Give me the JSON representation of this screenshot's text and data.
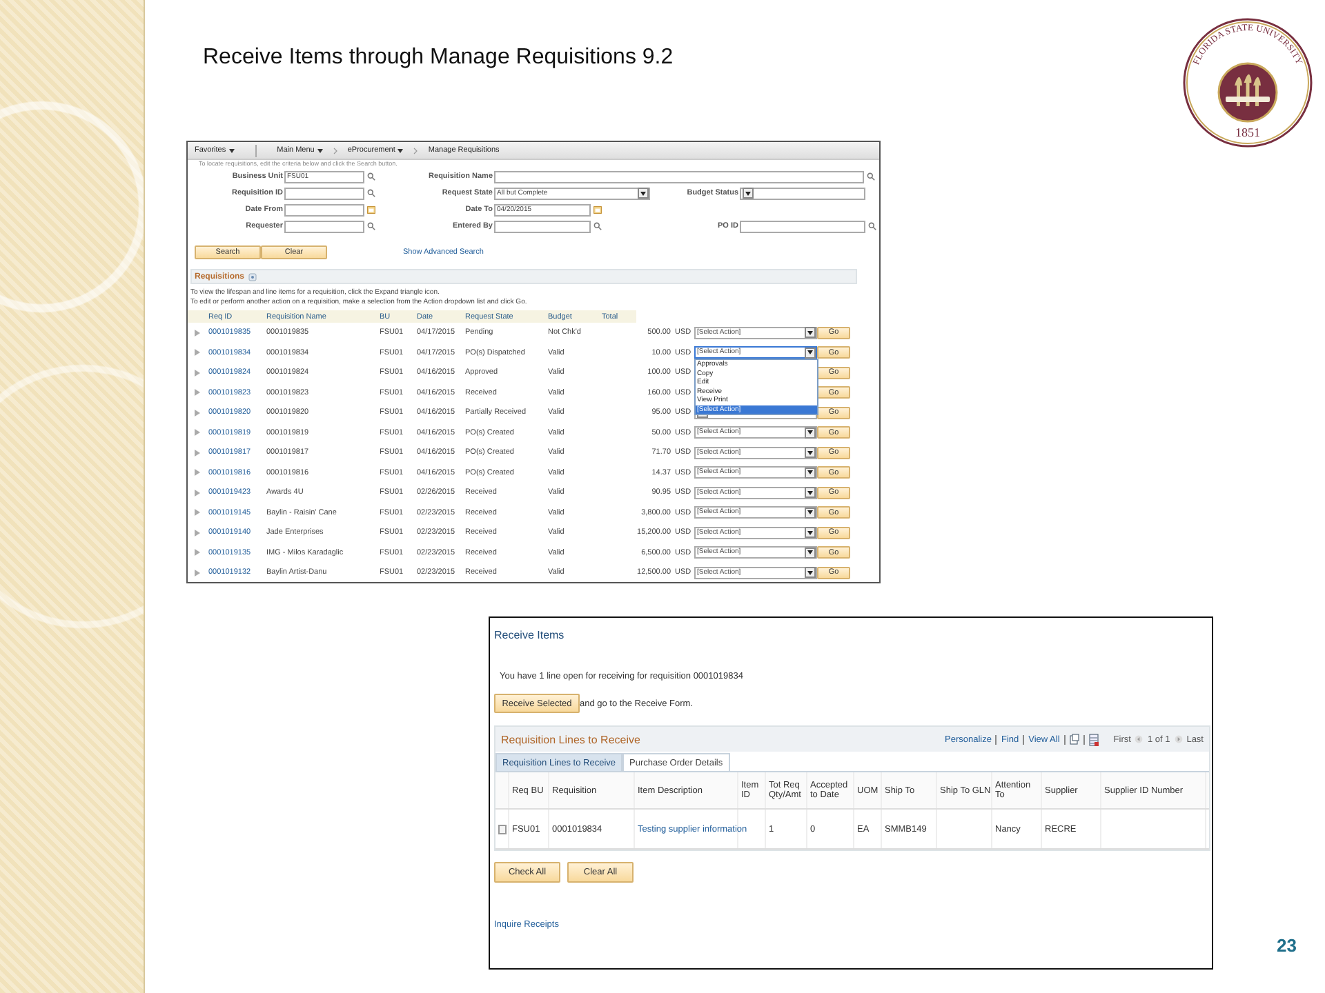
{
  "slide": {
    "title": "Receive Items through Manage Requisitions 9.2",
    "page_number": "23",
    "seal": {
      "name": "FLORIDA STATE UNIVERSITY",
      "year": "1851"
    }
  },
  "manage_requisitions": {
    "breadcrumbs": [
      {
        "label": "Favorites",
        "dropdown": true
      },
      {
        "label": "Main Menu",
        "dropdown": true
      },
      {
        "label": "eProcurement",
        "dropdown": true
      },
      {
        "label": "Manage Requisitions",
        "dropdown": false
      }
    ],
    "hint": "To locate requisitions, edit the criteria below and click the Search button.",
    "search_rows": [
      [
        {
          "label": "Business Unit",
          "kind": "lookup",
          "value": "FSU01",
          "wide": false
        },
        {
          "label": "Requisition Name",
          "kind": "lookup",
          "wide": true
        }
      ],
      [
        {
          "label": "Requisition ID",
          "kind": "lookup",
          "wide": false
        },
        {
          "label": "Request State",
          "kind": "select",
          "value": "All but Complete",
          "wide": false
        },
        {
          "label": "Budget Status",
          "kind": "select",
          "wide": false
        }
      ],
      [
        {
          "label": "Date From",
          "kind": "date",
          "wide": false
        },
        {
          "label": "Date To",
          "kind": "date",
          "value": "04/20/2015",
          "wide": false
        }
      ],
      [
        {
          "label": "Requester",
          "kind": "lookup",
          "wide": false
        },
        {
          "label": "Entered By",
          "kind": "lookup",
          "wide": false
        },
        {
          "label": "PO ID",
          "kind": "lookup",
          "wide": false
        }
      ]
    ],
    "buttons": [
      "Search",
      "Clear"
    ],
    "advanced_link": "Show Advanced Search",
    "section_title": "Requisitions",
    "instructions": [
      "To view the lifespan and line items for a requisition, click the Expand triangle icon.",
      "To edit or perform another action on a requisition, make a selection from the Action dropdown list and click Go."
    ],
    "columns": [
      "Req ID",
      "Requisition Name",
      "BU",
      "Date",
      "Request State",
      "Budget",
      "Total"
    ],
    "rows": [
      {
        "req_id": "0001019835",
        "name": "0001019835",
        "bu": "FSU01",
        "date": "04/17/2015",
        "state": "Pending",
        "budget": "Not Chk'd",
        "total": "500.00",
        "currency": "USD",
        "action": "[Select Action]",
        "go": "Go",
        "dropdown_open": false
      },
      {
        "req_id": "0001019834",
        "name": "0001019834",
        "bu": "FSU01",
        "date": "04/17/2015",
        "state": "PO(s) Dispatched",
        "budget": "Valid",
        "total": "10.00",
        "currency": "USD",
        "action": "[Select Action]",
        "go": "Go",
        "dropdown_open": true,
        "options": [
          {
            "label": "Approvals",
            "selected": false
          },
          {
            "label": "Copy",
            "selected": false
          },
          {
            "label": "Edit",
            "selected": false
          },
          {
            "label": "Receive",
            "selected": false
          },
          {
            "label": "View Print",
            "selected": false
          },
          {
            "label": "[Select Action]",
            "selected": true
          }
        ]
      },
      {
        "req_id": "0001019824",
        "name": "0001019824",
        "bu": "FSU01",
        "date": "04/16/2015",
        "state": "Approved",
        "budget": "Valid",
        "total": "100.00",
        "currency": "USD",
        "go": "Go",
        "dropdown_open": false
      },
      {
        "req_id": "0001019823",
        "name": "0001019823",
        "bu": "FSU01",
        "date": "04/16/2015",
        "state": "Received",
        "budget": "Valid",
        "total": "160.00",
        "currency": "USD",
        "go": "Go",
        "dropdown_open": false
      },
      {
        "req_id": "0001019820",
        "name": "0001019820",
        "bu": "FSU01",
        "date": "04/16/2015",
        "state": "Partially Received",
        "budget": "Valid",
        "total": "95.00",
        "currency": "USD",
        "go": "Go",
        "dropdown_open": false
      },
      {
        "req_id": "0001019819",
        "name": "0001019819",
        "bu": "FSU01",
        "date": "04/16/2015",
        "state": "PO(s) Created",
        "budget": "Valid",
        "total": "50.00",
        "currency": "USD",
        "action": "[Select Action]",
        "go": "Go",
        "dropdown_open": false
      },
      {
        "req_id": "0001019817",
        "name": "0001019817",
        "bu": "FSU01",
        "date": "04/16/2015",
        "state": "PO(s) Created",
        "budget": "Valid",
        "total": "71.70",
        "currency": "USD",
        "action": "[Select Action]",
        "go": "Go",
        "dropdown_open": false
      },
      {
        "req_id": "0001019816",
        "name": "0001019816",
        "bu": "FSU01",
        "date": "04/16/2015",
        "state": "PO(s) Created",
        "budget": "Valid",
        "total": "14.37",
        "currency": "USD",
        "action": "[Select Action]",
        "go": "Go",
        "dropdown_open": false
      },
      {
        "req_id": "0001019423",
        "name": "Awards 4U",
        "bu": "FSU01",
        "date": "02/26/2015",
        "state": "Received",
        "budget": "Valid",
        "total": "90.95",
        "currency": "USD",
        "action": "[Select Action]",
        "go": "Go",
        "dropdown_open": false
      },
      {
        "req_id": "0001019145",
        "name": "Baylin - Raisin' Cane",
        "bu": "FSU01",
        "date": "02/23/2015",
        "state": "Received",
        "budget": "Valid",
        "total": "3,800.00",
        "currency": "USD",
        "action": "[Select Action]",
        "go": "Go",
        "dropdown_open": false
      },
      {
        "req_id": "0001019140",
        "name": "Jade Enterprises",
        "bu": "FSU01",
        "date": "02/23/2015",
        "state": "Received",
        "budget": "Valid",
        "total": "15,200.00",
        "currency": "USD",
        "action": "[Select Action]",
        "go": "Go",
        "dropdown_open": false
      },
      {
        "req_id": "0001019135",
        "name": "IMG - Milos Karadaglic",
        "bu": "FSU01",
        "date": "02/23/2015",
        "state": "Received",
        "budget": "Valid",
        "total": "6,500.00",
        "currency": "USD",
        "action": "[Select Action]",
        "go": "Go",
        "dropdown_open": false
      },
      {
        "req_id": "0001019132",
        "name": "Baylin Artist-Danu",
        "bu": "FSU01",
        "date": "02/23/2015",
        "state": "Received",
        "budget": "Valid",
        "total": "12,500.00",
        "currency": "USD",
        "action": "[Select Action]",
        "go": "Go",
        "dropdown_open": false
      }
    ]
  },
  "receive_items": {
    "title": "Receive Items",
    "message": "You have 1 line open for receiving for requisition 0001019834",
    "receive_button": "Receive Selected",
    "receive_note": "and go to the Receive Form.",
    "grid": {
      "title": "Requisition Lines to Receive",
      "tools": [
        "Personalize",
        "Find",
        "View All"
      ],
      "pager": {
        "first": "First",
        "range": "1 of 1",
        "last": "Last"
      },
      "tabs": [
        {
          "label": "Requisition Lines to Receive",
          "selected": true
        },
        {
          "label": "Purchase Order Details",
          "selected": false
        }
      ],
      "columns": [
        "Req BU",
        "Requisition",
        "Item Description",
        "Item ID",
        "Tot Req Qty/Amt",
        "Accepted to Date",
        "UOM",
        "Ship To",
        "Ship To GLN",
        "Attention To",
        "Supplier",
        "Supplier ID Number"
      ],
      "rows": [
        {
          "checked": false,
          "req_bu": "FSU01",
          "requisition": "0001019834",
          "item_description": "Testing supplier information",
          "tot_req_qty_amt": "1",
          "accepted_to_date": "0",
          "uom": "EA",
          "ship_to": "SMMB149",
          "attention_to": "Nancy",
          "supplier": "RECRE"
        }
      ]
    },
    "buttons": [
      "Check All",
      "Clear All"
    ],
    "inquire_link": "Inquire Receipts"
  }
}
